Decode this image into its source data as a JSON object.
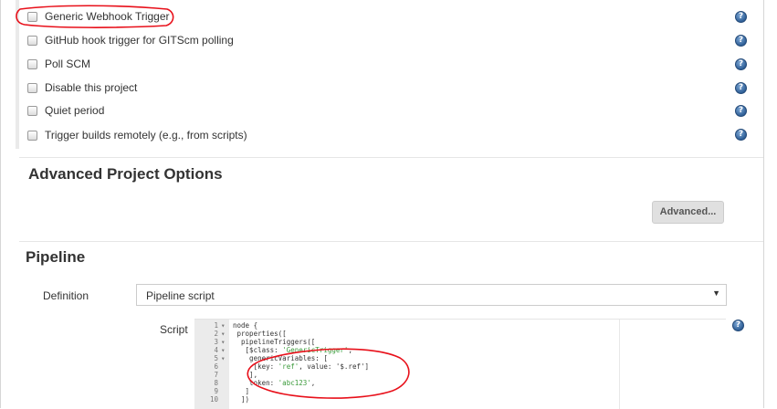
{
  "triggers": [
    {
      "label": "Generic Webhook Trigger",
      "checked": false
    },
    {
      "label": "GitHub hook trigger for GITScm polling",
      "checked": false
    },
    {
      "label": "Poll SCM",
      "checked": false
    },
    {
      "label": "Disable this project",
      "checked": false
    },
    {
      "label": "Quiet period",
      "checked": false
    },
    {
      "label": "Trigger builds remotely (e.g., from scripts)",
      "checked": false
    }
  ],
  "help_glyph": "?",
  "advanced_options": {
    "heading": "Advanced Project Options",
    "button_label": "Advanced..."
  },
  "pipeline": {
    "heading": "Pipeline",
    "definition_label": "Definition",
    "definition_value": "Pipeline script",
    "dropdown_arrow": "▼",
    "script_label": "Script",
    "script_lines": [
      {
        "num": "1",
        "fold": "▾",
        "pre": "node {",
        "str": "",
        "post": ""
      },
      {
        "num": "2",
        "fold": "▾",
        "pre": " properties([",
        "str": "",
        "post": ""
      },
      {
        "num": "3",
        "fold": "▾",
        "pre": "  pipelineTriggers([",
        "str": "",
        "post": ""
      },
      {
        "num": "4",
        "fold": "▾",
        "pre": "   [$class: ",
        "str": "'GenericTrigger'",
        "post": ","
      },
      {
        "num": "5",
        "fold": "▾",
        "pre": "    genericVariables: [",
        "str": "",
        "post": ""
      },
      {
        "num": "6",
        "fold": "",
        "pre": "     [key: ",
        "str": "'ref'",
        "post": ", value: '$.ref']"
      },
      {
        "num": "7",
        "fold": "",
        "pre": "    ],",
        "str": "",
        "post": ""
      },
      {
        "num": "8",
        "fold": "",
        "pre": "    token: ",
        "str": "'abc123'",
        "post": ","
      },
      {
        "num": "9",
        "fold": "",
        "pre": "   ]",
        "str": "",
        "post": ""
      },
      {
        "num": "10",
        "fold": "",
        "pre": "  ])",
        "str": "",
        "post": ""
      }
    ]
  },
  "colors": {
    "annotation_red": "#e8101a",
    "help_blue": "#2f5f97",
    "string_green": "#3a9a3a"
  }
}
